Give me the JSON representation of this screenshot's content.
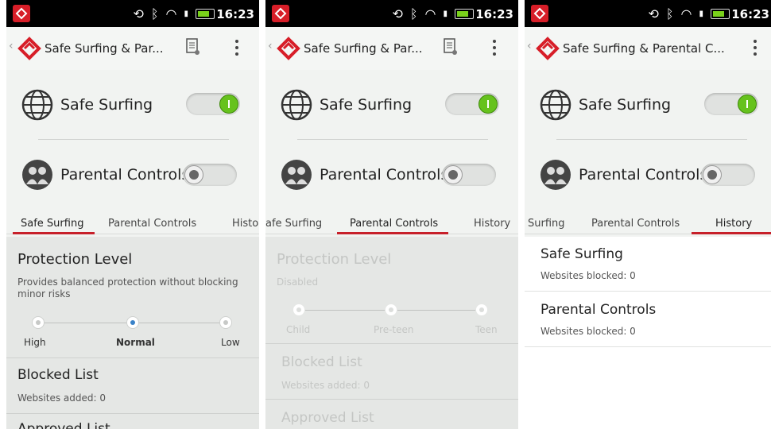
{
  "status_bar": {
    "time": "16:23"
  },
  "app": {
    "title_short": "Safe Surfing & Par...",
    "title_long": "Safe Surfing & Parental C..."
  },
  "features": {
    "safe_surfing": {
      "label": "Safe Surfing",
      "enabled": true
    },
    "parental_controls": {
      "label": "Parental Controls",
      "enabled": false
    }
  },
  "tabs": {
    "screen1": [
      "Safe Surfing",
      "Parental Controls",
      "Histo"
    ],
    "screen2": [
      "afe Surfing",
      "Parental Controls",
      "History"
    ],
    "screen3": [
      "Surfing",
      "Parental Controls",
      "History"
    ]
  },
  "safe_surfing_tab": {
    "protection_title": "Protection Level",
    "protection_desc": "Provides balanced protection without blocking minor risks",
    "levels": [
      "High",
      "Normal",
      "Low"
    ],
    "selected_level": "Normal",
    "blocked_title": "Blocked List",
    "blocked_sub": "Websites added: 0",
    "approved_title": "Approved List"
  },
  "parental_tab": {
    "protection_title": "Protection Level",
    "protection_desc": "Disabled",
    "levels": [
      "Child",
      "Pre-teen",
      "Teen"
    ],
    "blocked_title": "Blocked List",
    "blocked_sub": "Websites added: 0",
    "approved_title": "Approved List"
  },
  "history_tab": {
    "items": [
      {
        "title": "Safe Surfing",
        "sub": "Websites blocked: 0"
      },
      {
        "title": "Parental Controls",
        "sub": "Websites blocked: 0"
      }
    ]
  },
  "colors": {
    "accent_red": "#c7202a",
    "toggle_green": "#66c21d",
    "selected_blue": "#3a82c8"
  },
  "icons": [
    "app-logo-icon",
    "sync-icon",
    "bluetooth-icon",
    "wifi-icon",
    "signal-icon",
    "battery-icon",
    "notes-icon",
    "more-vert-icon",
    "globe-icon",
    "family-icon"
  ]
}
